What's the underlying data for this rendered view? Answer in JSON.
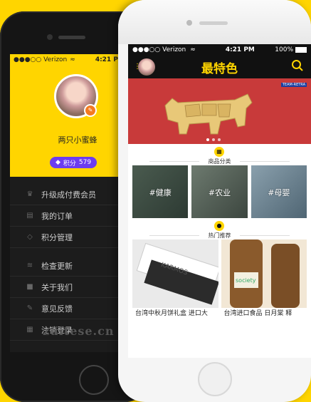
{
  "back_app": {
    "status": {
      "carrier": "●●●○○ Verizon",
      "wifi": "≈",
      "time": "4:21 PM"
    },
    "profile": {
      "username": "两只小蜜蜂",
      "points_label": "积分",
      "points_value": "579"
    },
    "menu_group1": [
      {
        "label": "升级成付费会员",
        "icon": "crown-icon"
      },
      {
        "label": "我的订单",
        "icon": "clipboard-icon"
      },
      {
        "label": "积分管理",
        "icon": "diamond-icon"
      }
    ],
    "menu_group2": [
      {
        "label": "检查更新",
        "icon": "layers-icon"
      },
      {
        "label": "关于我们",
        "icon": "camera-icon"
      },
      {
        "label": "意见反馈",
        "icon": "edit-icon"
      },
      {
        "label": "注销登录",
        "icon": "grid-icon"
      }
    ],
    "watermark": "zuitese.cn"
  },
  "front_app": {
    "status": {
      "carrier": "●●●○○ Verizon",
      "wifi": "≈",
      "time": "4:21 PM",
      "battery": "100%"
    },
    "header": {
      "title": "最特色"
    },
    "banner": {
      "tag": "TEAM-RETRA"
    },
    "sections": {
      "categories_title": "商品分类",
      "hot_title": "热门推荐"
    },
    "categories": [
      "#健康",
      "#农业",
      "#母婴"
    ],
    "products": [
      {
        "name": "台湾中秋月饼礼盒 进口大",
        "brand": "KARMOS"
      },
      {
        "name": "台湾进口食品 日月棠 释",
        "brand": "society"
      }
    ],
    "colors": {
      "accent": "#ffd500",
      "dark": "#111111"
    }
  }
}
